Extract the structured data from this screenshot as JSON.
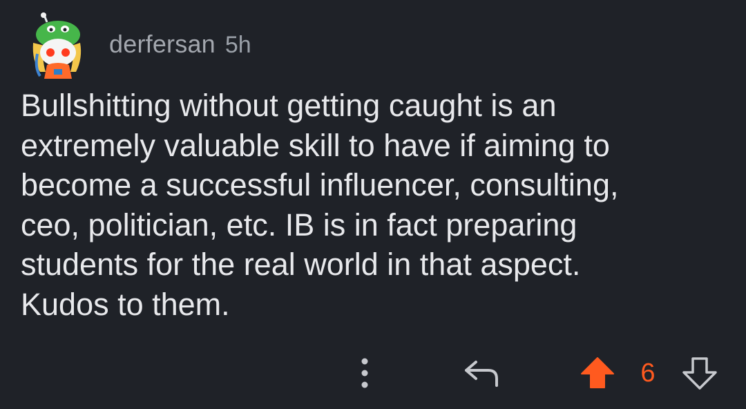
{
  "comment": {
    "author": "derfersan",
    "age": "5h",
    "body": "Bullshitting without getting caught is an\nextremely valuable skill to have if aiming to\nbecome a successful influencer, consulting,\nceo, politician, etc. IB is in fact preparing\nstudents for the real world in that aspect.\nKudos to them.",
    "score": "6",
    "vote_state": "upvoted"
  },
  "icons": {
    "more": "more-vertical-icon",
    "reply": "reply-icon",
    "upvote": "upvote-arrow-icon",
    "downvote": "downvote-arrow-icon"
  },
  "colors": {
    "background": "#1f2228",
    "text": "#e8e9ec",
    "muted": "#a3a7ae",
    "upvote": "#ff5a1f"
  }
}
